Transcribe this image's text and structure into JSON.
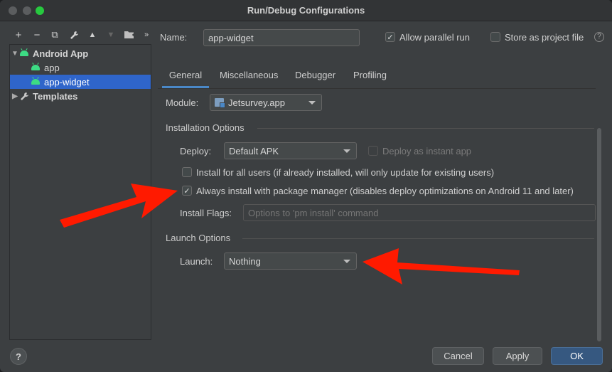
{
  "window": {
    "title": "Run/Debug Configurations"
  },
  "toolbar": {
    "add": "+",
    "remove": "−",
    "copy": "⧉",
    "edit": "🔧",
    "up": "▲",
    "down": "▼",
    "folder": "📁",
    "more": "»"
  },
  "tree": {
    "items": [
      {
        "label": "Android App",
        "expanded": true
      },
      {
        "label": "app"
      },
      {
        "label": "app-widget",
        "selected": true
      },
      {
        "label": "Templates",
        "expanded": false
      }
    ]
  },
  "name_row": {
    "label": "Name:",
    "value": "app-widget",
    "parallel_label": "Allow parallel run",
    "parallel_checked": true,
    "store_label": "Store as project file",
    "store_checked": false
  },
  "tabs": [
    "General",
    "Miscellaneous",
    "Debugger",
    "Profiling"
  ],
  "general": {
    "module_label": "Module:",
    "module_value": "Jetsurvey.app",
    "installation_title": "Installation Options",
    "deploy_label": "Deploy:",
    "deploy_value": "Default APK",
    "instant_label": "Deploy as instant app",
    "install_all_label": "Install for all users (if already installed, will only update for existing users)",
    "install_all_checked": false,
    "package_manager_label": "Always install with package manager (disables deploy optimizations on Android 11 and later)",
    "package_manager_checked": true,
    "flags_label": "Install Flags:",
    "flags_placeholder": "Options to 'pm install' command",
    "launch_title": "Launch Options",
    "launch_label": "Launch:",
    "launch_value": "Nothing"
  },
  "buttons": {
    "help": "?",
    "cancel": "Cancel",
    "apply": "Apply",
    "ok": "OK"
  },
  "colors": {
    "accent": "#2f65ca",
    "primary_button": "#365880",
    "annotation_arrow": "#ff1a00"
  }
}
